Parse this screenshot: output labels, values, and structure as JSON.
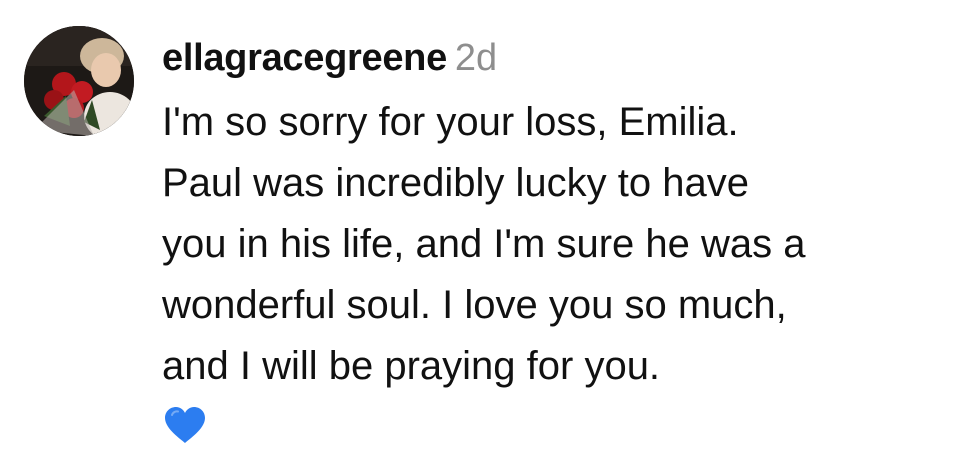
{
  "comment": {
    "username": "ellagracegreene",
    "timestamp": "2d",
    "text_lines": [
      "I'm so sorry for your loss, Emilia.",
      "Paul was incredibly lucky to have",
      "you in his life, and I'm sure he was a",
      "wonderful soul. I love you so much,",
      "and I will be praying for you."
    ],
    "emoji": "blue-heart",
    "emoji_color": "#2c7df0"
  }
}
